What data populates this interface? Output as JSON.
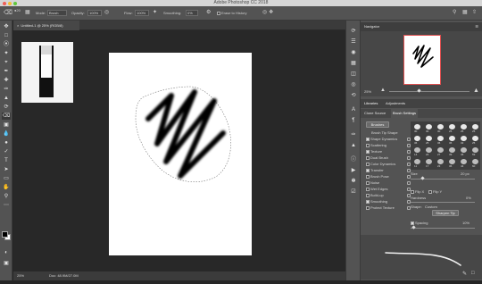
{
  "app": {
    "window_title": "Adobe Photoshop CC 2018"
  },
  "options_bar": {
    "mode_label": "Mode:",
    "mode_value": "Brush",
    "opacity_label": "Opacity:",
    "opacity_value": "100%",
    "flow_label": "Flow:",
    "flow_value": "100%",
    "smoothing_label": "Smoothing:",
    "smoothing_value": "0%",
    "erase_to_history": "Erase to History",
    "brush_size": "20"
  },
  "document": {
    "tab_label": "Untitled-1 @ 25% (RGB/8)",
    "zoom": "25%",
    "doc_info": "Doc: 48.9M/27.0M"
  },
  "navigator": {
    "title": "Navigator",
    "zoom": "25%"
  },
  "libraries_tabs": [
    "Libraries",
    "Adjustments"
  ],
  "brush_tabs": [
    "Clone Source",
    "Brush Settings"
  ],
  "brushes_button": "Brushes",
  "brush_options": [
    {
      "label": "Brush Tip Shape",
      "checked": null
    },
    {
      "label": "Shape Dynamics",
      "checked": true
    },
    {
      "label": "Scattering",
      "checked": false
    },
    {
      "label": "Texture",
      "checked": true
    },
    {
      "label": "Dual Brush",
      "checked": false
    },
    {
      "label": "Color Dynamics",
      "checked": false
    },
    {
      "label": "Transfer",
      "checked": true
    },
    {
      "label": "Brush Pose",
      "checked": false
    },
    {
      "label": "Noise",
      "checked": false
    },
    {
      "label": "Wet Edges",
      "checked": false
    },
    {
      "label": "Build-up",
      "checked": false
    },
    {
      "label": "Smoothing",
      "checked": true
    },
    {
      "label": "Protect Texture",
      "checked": false
    }
  ],
  "brush_tip_sizes": [
    "30",
    "30",
    "30",
    "25",
    "25",
    "25",
    "36",
    "25",
    "36",
    "36",
    "32",
    "25",
    "14",
    "24",
    "27",
    "39",
    "46",
    "59",
    "11",
    "17",
    "23",
    "36",
    "44",
    "60"
  ],
  "brush_settings": {
    "size_label": "Size",
    "size_value": "20 px",
    "flip_x": "Flip X",
    "flip_y": "Flip Y",
    "hardness_label": "Hardness",
    "hardness_value": "0%",
    "shape_label": "Shape:",
    "shape_value": "Custom",
    "sharpen_tip": "Sharpen Tip",
    "spacing_label": "Spacing",
    "spacing_value": "10%"
  },
  "colors": {
    "foreground": "#000000",
    "background": "#ffffff",
    "panel_bg": "#535353",
    "workspace_bg": "#282828"
  },
  "icons": [
    "move-icon",
    "marquee-icon",
    "lasso-icon",
    "quick-select-icon",
    "crop-icon",
    "eyedropper-icon",
    "healing-icon",
    "brush-icon",
    "clone-stamp-icon",
    "history-brush-icon",
    "eraser-icon",
    "gradient-icon",
    "blur-icon",
    "dodge-icon",
    "pen-icon",
    "type-icon",
    "path-select-icon",
    "rectangle-icon",
    "hand-icon",
    "zoom-icon"
  ]
}
